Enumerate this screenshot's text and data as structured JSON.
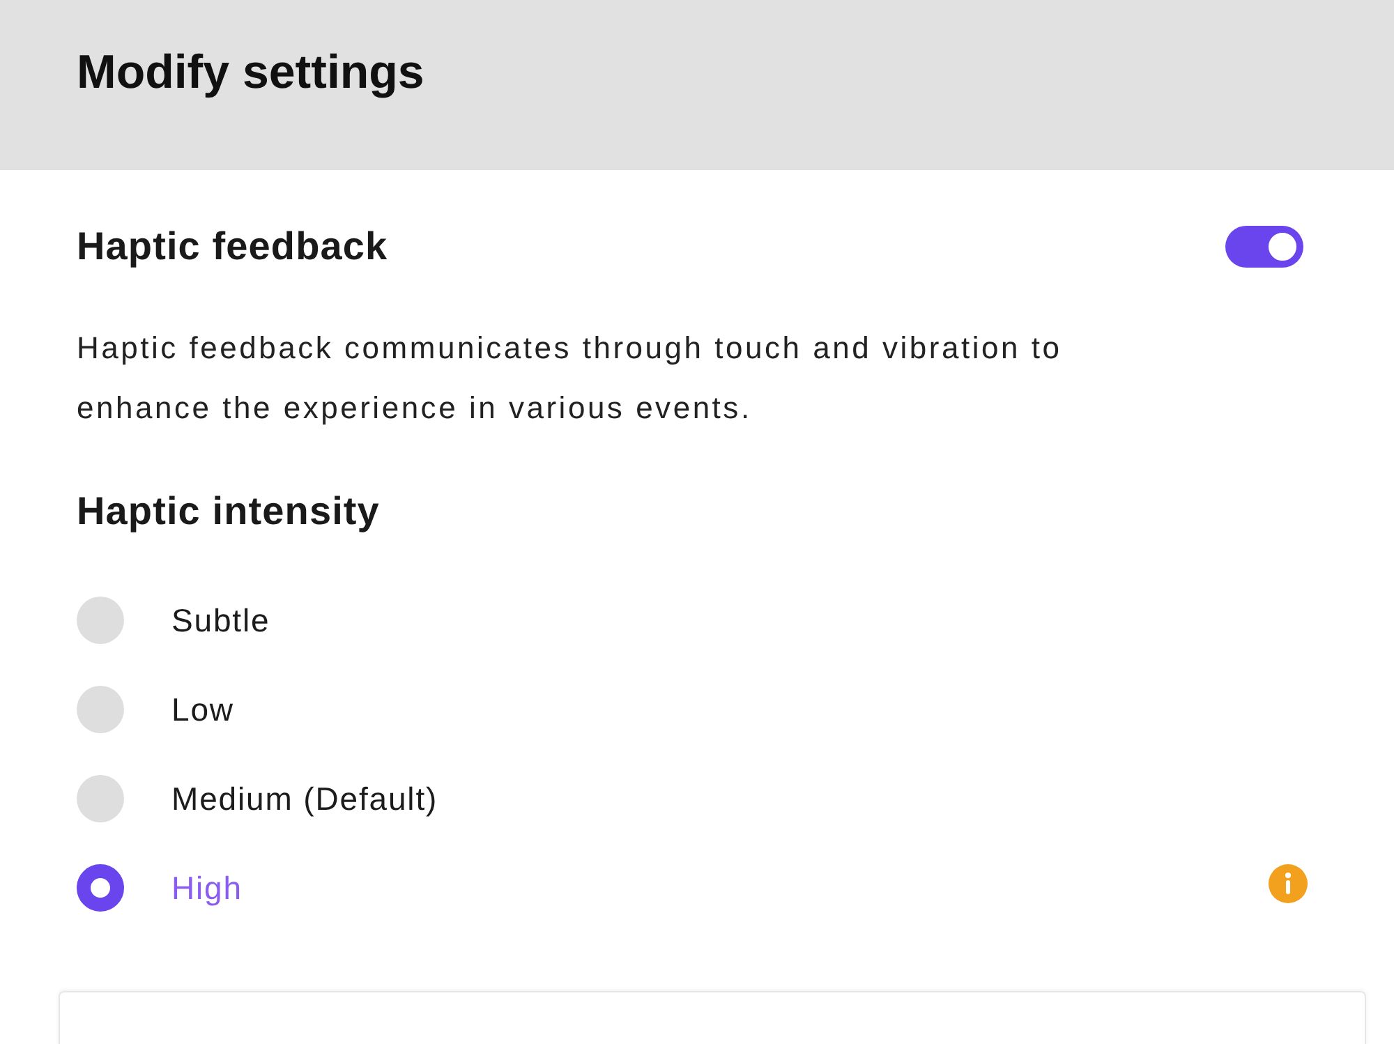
{
  "header": {
    "title": "Modify settings"
  },
  "haptic_feedback": {
    "title": "Haptic feedback",
    "on": true,
    "description": "Haptic feedback communicates through touch and vibration to enhance the experience in various events."
  },
  "haptic_intensity": {
    "title": "Haptic intensity",
    "options": [
      {
        "label": "Subtle",
        "selected": false,
        "info": false
      },
      {
        "label": "Low",
        "selected": false,
        "info": false
      },
      {
        "label": "Medium (Default)",
        "selected": false,
        "info": false
      },
      {
        "label": "High",
        "selected": true,
        "info": true
      }
    ]
  }
}
